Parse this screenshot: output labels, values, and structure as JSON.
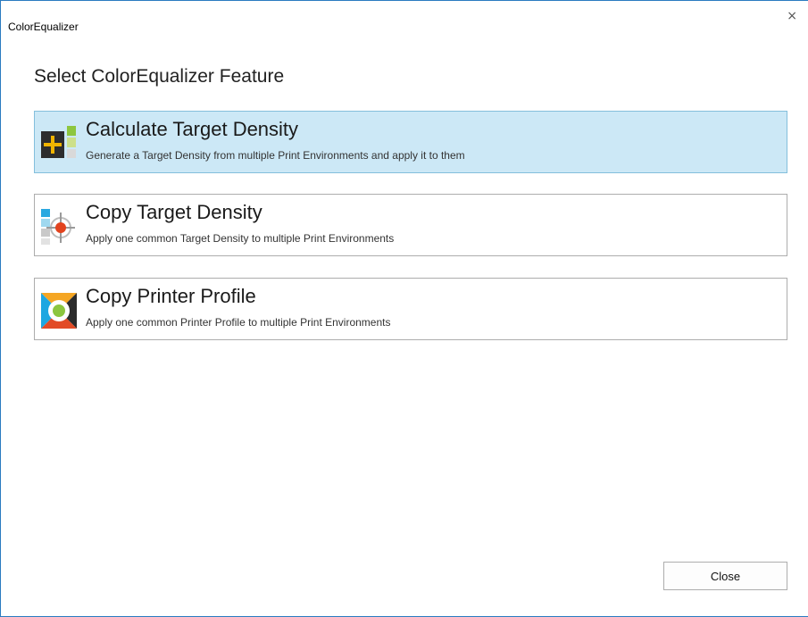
{
  "window": {
    "title": "ColorEqualizer",
    "close_glyph": "×"
  },
  "page": {
    "heading": "Select ColorEqualizer Feature"
  },
  "features": [
    {
      "title": "Calculate Target Density",
      "description": "Generate a Target Density from multiple Print Environments and apply it to them",
      "icon": "calculate-density-icon",
      "selected": true
    },
    {
      "title": "Copy Target Density",
      "description": "Apply one common Target Density to multiple Print Environments",
      "icon": "copy-target-density-icon",
      "selected": false
    },
    {
      "title": "Copy Printer Profile",
      "description": "Apply one common Printer Profile to multiple Print Environments",
      "icon": "copy-printer-profile-icon",
      "selected": false
    }
  ],
  "footer": {
    "close_label": "Close"
  },
  "colors": {
    "selected_bg": "#cce8f6",
    "window_border": "#2b7bc0"
  }
}
